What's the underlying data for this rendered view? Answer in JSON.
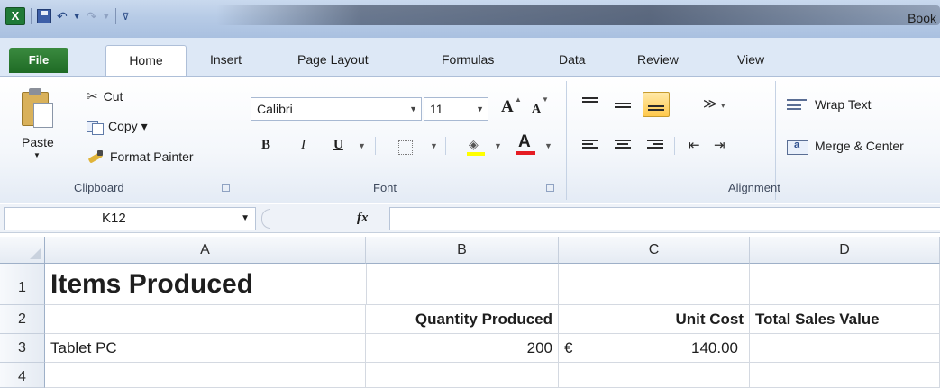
{
  "window": {
    "title": "Book"
  },
  "quick_access": {
    "logo": "X",
    "icons": [
      "excel-logo-icon",
      "save-icon",
      "undo-icon",
      "redo-icon",
      "customize-icon"
    ]
  },
  "ribbon_tabs": [
    "File",
    "Home",
    "Insert",
    "Page Layout",
    "Formulas",
    "Data",
    "Review",
    "View"
  ],
  "active_tab": "Home",
  "clipboard": {
    "paste_label": "Paste",
    "cut_label": "Cut",
    "copy_label": "Copy ▾",
    "format_painter_label": "Format Painter",
    "group_label": "Clipboard"
  },
  "font": {
    "name": "Calibri",
    "size": "11",
    "grow_label": "A",
    "shrink_label": "A",
    "bold_label": "B",
    "italic_label": "I",
    "underline_label": "U",
    "group_label": "Font",
    "fill_color": "#ffff00",
    "font_color": "#e51c23"
  },
  "alignment": {
    "wrap_text_label": "Wrap Text",
    "merge_center_label": "Merge & Center",
    "group_label": "Alignment"
  },
  "formula_bar": {
    "name_box": "K12",
    "fx_label": "fx",
    "formula": ""
  },
  "sheet": {
    "columns": [
      "A",
      "B",
      "C",
      "D"
    ],
    "rows": [
      {
        "num": "1",
        "cells": [
          "Items Produced",
          "",
          "",
          ""
        ]
      },
      {
        "num": "2",
        "cells": [
          "",
          "Quantity Produced",
          "Unit Cost",
          "Total Sales Value"
        ]
      },
      {
        "num": "3",
        "cells": [
          "Tablet PC",
          "200",
          "140.00",
          ""
        ],
        "currency": "€"
      },
      {
        "num": "4",
        "cells": [
          "",
          "",
          "",
          ""
        ]
      }
    ]
  }
}
